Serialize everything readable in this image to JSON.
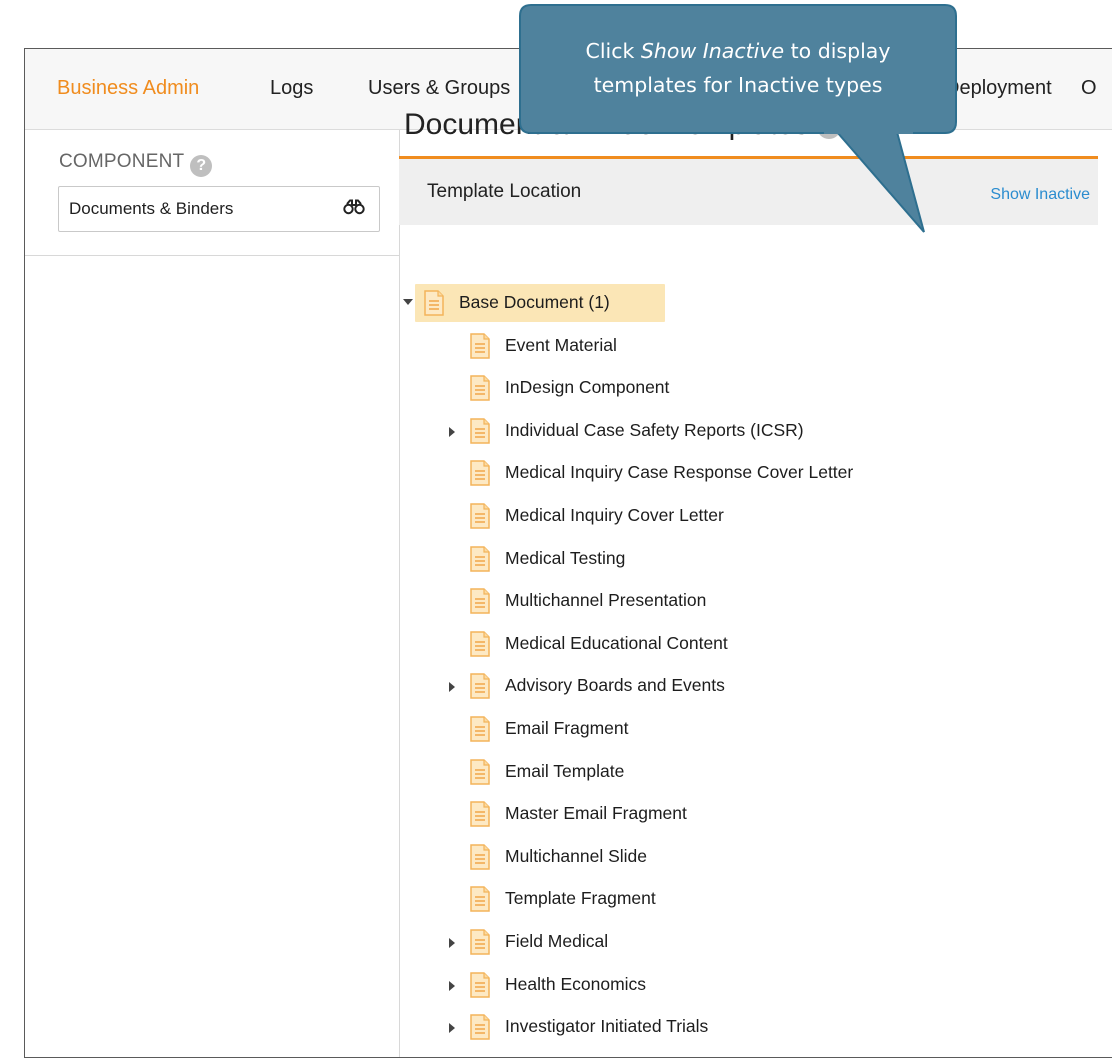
{
  "topnav": {
    "items": [
      "Business Admin",
      "Logs",
      "Users & Groups",
      "Deployment",
      "O"
    ]
  },
  "sidebar": {
    "component_label": "COMPONENT",
    "help": "?",
    "selected_component": "Documents & Binders"
  },
  "main": {
    "title": "Document & Binder Templates",
    "help": "?",
    "location_label": "Template Location",
    "show_inactive": "Show Inactive"
  },
  "tree": [
    {
      "label": "Base Document (1)",
      "toggle": "expanded",
      "level": 0,
      "selected": true
    },
    {
      "label": "Event Material",
      "toggle": "none",
      "level": 1
    },
    {
      "label": "InDesign Component",
      "toggle": "none",
      "level": 1
    },
    {
      "label": "Individual Case Safety Reports (ICSR)",
      "toggle": "collapsed",
      "level": 1
    },
    {
      "label": "Medical Inquiry Case Response Cover Letter",
      "toggle": "none",
      "level": 1
    },
    {
      "label": "Medical Inquiry Cover Letter",
      "toggle": "none",
      "level": 1
    },
    {
      "label": "Medical Testing",
      "toggle": "none",
      "level": 1
    },
    {
      "label": "Multichannel Presentation",
      "toggle": "none",
      "level": 1
    },
    {
      "label": "Medical Educational Content",
      "toggle": "none",
      "level": 1
    },
    {
      "label": "Advisory Boards and Events",
      "toggle": "collapsed",
      "level": 1
    },
    {
      "label": "Email Fragment",
      "toggle": "none",
      "level": 1
    },
    {
      "label": "Email Template",
      "toggle": "none",
      "level": 1
    },
    {
      "label": "Master Email Fragment",
      "toggle": "none",
      "level": 1
    },
    {
      "label": "Multichannel Slide",
      "toggle": "none",
      "level": 1
    },
    {
      "label": "Template Fragment",
      "toggle": "none",
      "level": 1
    },
    {
      "label": "Field Medical",
      "toggle": "collapsed",
      "level": 1
    },
    {
      "label": "Health Economics",
      "toggle": "collapsed",
      "level": 1
    },
    {
      "label": "Investigator Initiated Trials",
      "toggle": "collapsed",
      "level": 1
    }
  ],
  "callout": {
    "prefix": "Click ",
    "emphasis": "Show Inactive",
    "suffix": " to display",
    "line2": "templates for Inactive types"
  },
  "colors": {
    "accent": "#f08c1e",
    "link": "#2a8ccf",
    "callout_fill": "#4f829d",
    "callout_border": "#2e6f8f",
    "selected_bg": "#fbe6b6"
  }
}
